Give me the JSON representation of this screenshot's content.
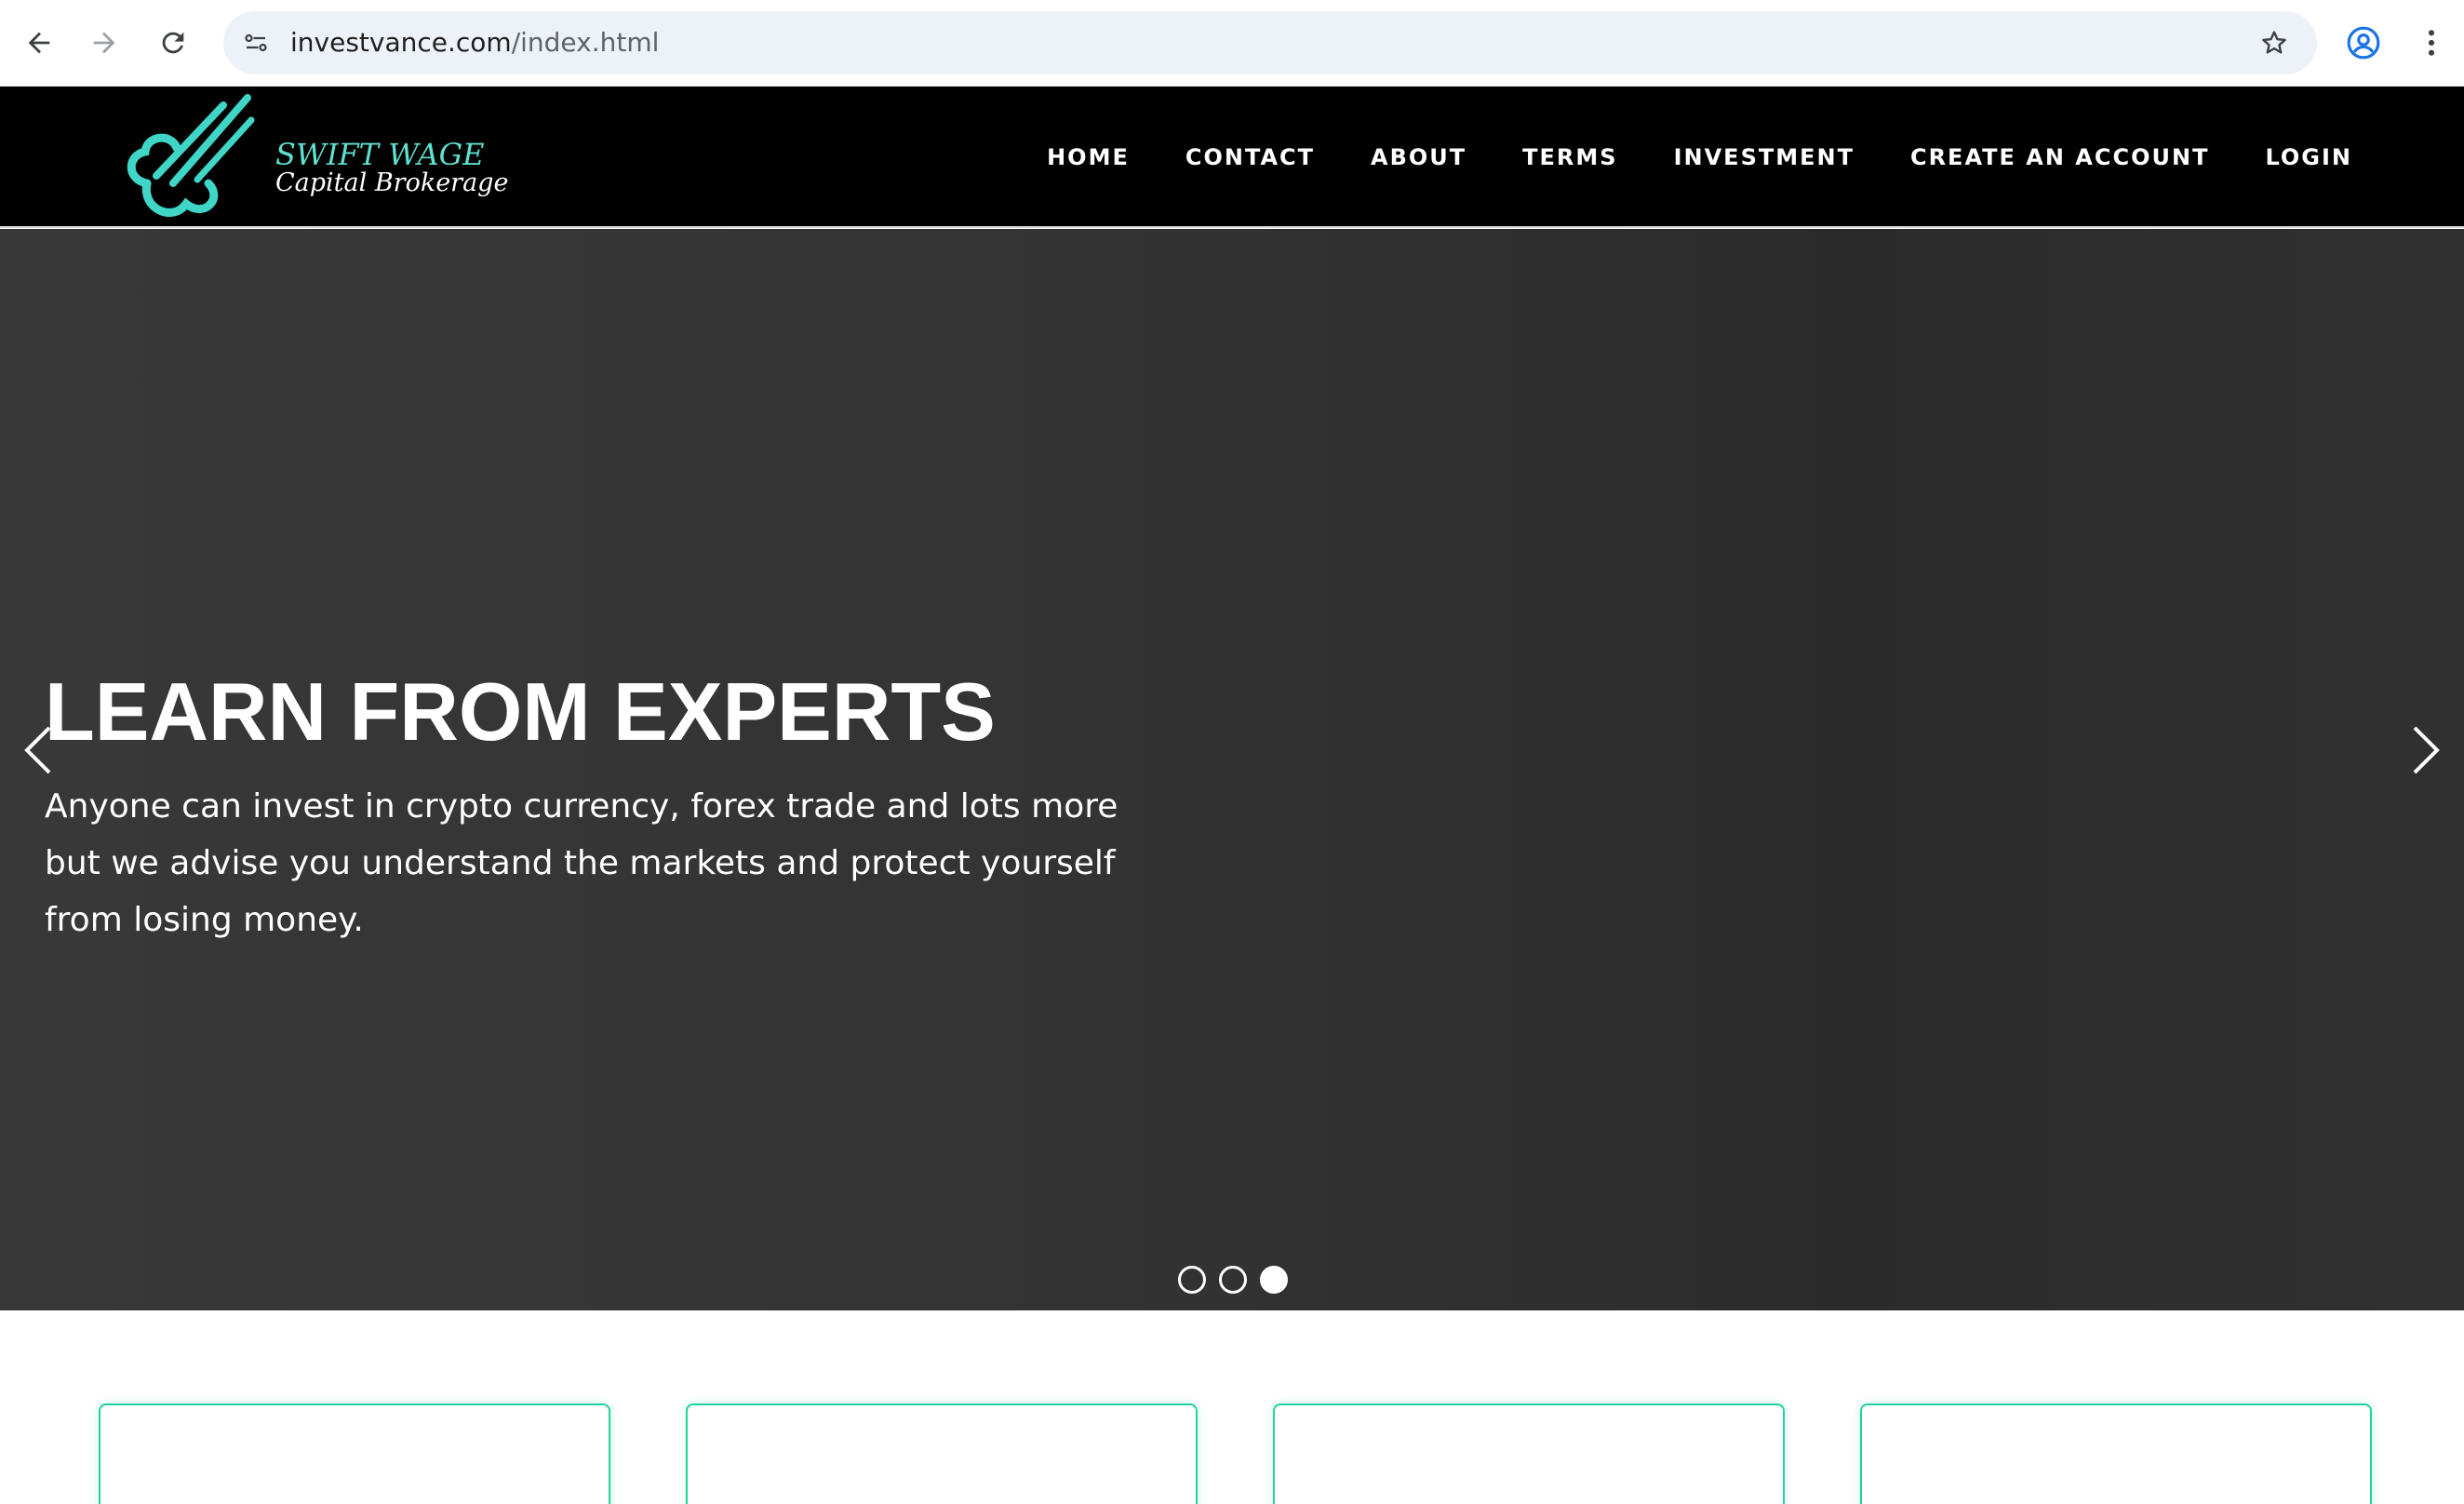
{
  "browser": {
    "url_domain": "investvance.com",
    "url_path": "/index.html",
    "icons": [
      "back-arrow-icon",
      "forward-arrow-icon",
      "reload-icon",
      "site-info-icon",
      "bookmark-star-icon",
      "profile-icon",
      "more-vert-icon"
    ]
  },
  "header": {
    "logo_title": "SWIFT WAGE",
    "logo_subtitle": "Capital Brokerage",
    "nav": [
      "HOME",
      "CONTACT",
      "ABOUT",
      "TERMS",
      "INVESTMENT",
      "CREATE AN ACCOUNT",
      "LOGIN"
    ]
  },
  "hero": {
    "title": "LEARN FROM EXPERTS",
    "text": "Anyone can invest in crypto currency, forex trade and lots more but we advise you understand the markets and protect yourself from losing money.",
    "slide_count": 3,
    "active_slide": 3
  },
  "colors": {
    "accent": "#5fe0d0",
    "card_border": "#22d3a0",
    "header_bg": "#000000",
    "hero_bg": "#333333"
  }
}
